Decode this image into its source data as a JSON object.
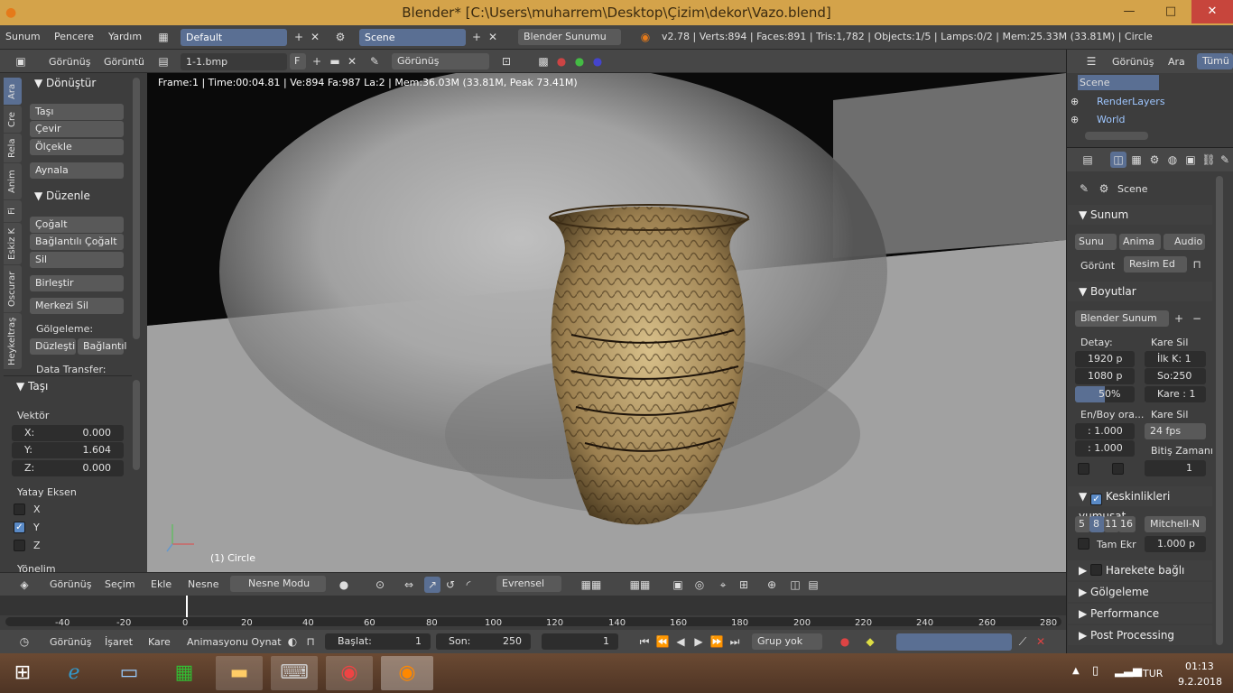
{
  "window": {
    "title": "Blender* [C:\\Users\\muharrem\\Desktop\\Çizim\\dekor\\Vazo.blend]",
    "close": "✕",
    "max": "□",
    "min": "—"
  },
  "infobar": {
    "menus": [
      "Sunum",
      "Pencere",
      "Yardım"
    ],
    "layout": "Default",
    "scene": "Scene",
    "engine": "Blender Sunumu",
    "stats": "v2.78 | Verts:894 | Faces:891 | Tris:1,782 | Objects:1/5 | Lamps:0/2 | Mem:25.33M (33.81M) | Circle"
  },
  "vpheader": {
    "menu1": "Görünüş",
    "menu2": "Görüntü",
    "image": "1-1.bmp",
    "f": "F",
    "mode": "Görünüş"
  },
  "toolshelf": {
    "tabs": [
      "Ara",
      "Cre",
      "Rela",
      "Anim",
      "Fi",
      "Eskiz K",
      "Oscurar",
      "Heykeltraş"
    ],
    "transform_title": "Dönüştür",
    "transform_btns": [
      "Taşı",
      "Çevir",
      "Ölçekle"
    ],
    "mirror": "Aynala",
    "edit_title": "Düzenle",
    "edit_btns": [
      "Çoğalt",
      "Bağlantılı Çoğalt",
      "Sil"
    ],
    "join": "Birleştir",
    "origin": "Merkezi Sil",
    "shading_label": "Gölgeleme:",
    "smooth": "Düzleşti",
    "smooth2": "Bağlantıl",
    "data_transfer": "Data Transfer:",
    "op_title": "Taşı",
    "vector": "Vektör",
    "x_label": "X:",
    "x_val": "0.000",
    "y_label": "Y:",
    "y_val": "1.604",
    "z_label": "Z:",
    "z_val": "0.000",
    "axis_title": "Yatay Eksen",
    "ax": "X",
    "ay": "Y",
    "az": "Z",
    "orient": "Yönelim"
  },
  "viewport": {
    "info": "Frame:1 | Time:00:04.81 | Ve:894 Fa:987 La:2 | Mem:36.03M (33.81M, Peak 73.41M)",
    "object": "(1) Circle"
  },
  "vpfooter": {
    "menus": [
      "Görünüş",
      "Seçim",
      "Ekle",
      "Nesne"
    ],
    "mode": "Nesne Modu",
    "orientation": "Evrensel"
  },
  "timeline": {
    "ticks": [
      "-40",
      "-20",
      "0",
      "20",
      "40",
      "60",
      "80",
      "100",
      "120",
      "140",
      "160",
      "180",
      "200",
      "220",
      "240",
      "260",
      "280"
    ]
  },
  "tlfooter": {
    "menus": [
      "Görünüş",
      "İşaret",
      "Kare",
      "Animasyonu Oynat"
    ],
    "start_label": "Başlat:",
    "start": "1",
    "end_label": "Son:",
    "end": "250",
    "current": "1",
    "keying": "Grup yok"
  },
  "outliner": {
    "menus": [
      "Görünüş",
      "Ara",
      "Tümü"
    ],
    "items": [
      "Scene",
      "RenderLayers",
      "World"
    ]
  },
  "props": {
    "context": "Scene",
    "render_title": "Sunum",
    "render_btns": [
      "Sunu",
      "Anima",
      "Audio"
    ],
    "display_label": "Görünt",
    "display_val": "Resim Ed",
    "dims_title": "Boyutlar",
    "preset": "Blender Sunum",
    "res_label": "Detay:",
    "frames_label": "Kare Sil",
    "res_x": "1920 p",
    "res_y": "1080 p",
    "res_pct": "50%",
    "start": "İlk K:  1",
    "end": "So:250",
    "step": "Kare : 1",
    "aspect_label": "En/Boy ora...",
    "fps_label": "Kare Sil",
    "asp_x": ": 1.000",
    "asp_y": ": 1.000",
    "fps": "24 fps",
    "time_remap": "Bitiş Zamanı",
    "remap_val": "1",
    "aa_title": "Keskinlikleri yumuşat",
    "aa_samples": [
      "5",
      "8",
      "11",
      "16"
    ],
    "aa_filter": "Mitchell-N",
    "full_sample": "Tam Ekr",
    "filter_size": "1.000 p",
    "mb_title": "Harekete bağlı bulanı",
    "shading_title": "Gölgeleme",
    "perf_title": "Performance",
    "post_title": "Post Processing"
  },
  "taskbar": {
    "lang": "TUR",
    "time": "01:13",
    "date": "9.2.2018"
  }
}
